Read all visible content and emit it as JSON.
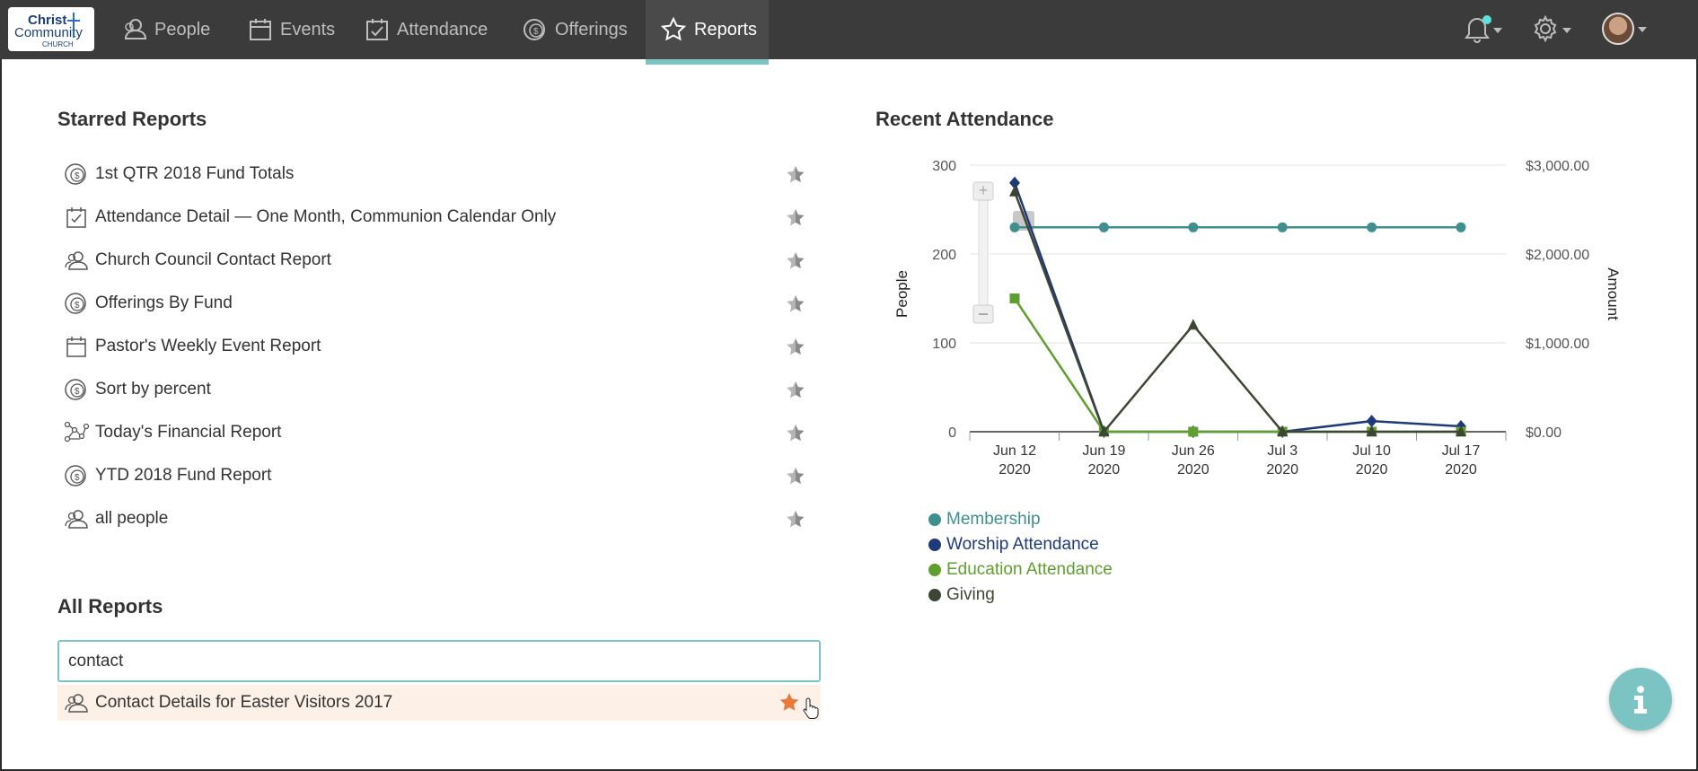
{
  "logo": {
    "line1": "Christ",
    "line2": "Community",
    "line3": "CHURCH"
  },
  "nav": [
    {
      "label": "People",
      "icon": "people-icon"
    },
    {
      "label": "Events",
      "icon": "calendar-icon"
    },
    {
      "label": "Attendance",
      "icon": "calendar-check-icon"
    },
    {
      "label": "Offerings",
      "icon": "coin-icon"
    },
    {
      "label": "Reports",
      "icon": "star-icon",
      "active": true
    }
  ],
  "starred": {
    "title": "Starred Reports",
    "items": [
      {
        "label": "1st QTR 2018 Fund Totals",
        "icon": "coin-icon"
      },
      {
        "label": "Attendance Detail — One Month, Communion Calendar Only",
        "icon": "calendar-check-icon"
      },
      {
        "label": "Church Council Contact Report",
        "icon": "people-icon"
      },
      {
        "label": "Offerings By Fund",
        "icon": "coin-icon"
      },
      {
        "label": "Pastor's Weekly Event Report",
        "icon": "calendar-icon"
      },
      {
        "label": "Sort by percent",
        "icon": "coin-icon"
      },
      {
        "label": "Today's Financial Report",
        "icon": "network-icon"
      },
      {
        "label": "YTD 2018 Fund Report",
        "icon": "coin-icon"
      },
      {
        "label": "all people",
        "icon": "people-icon"
      }
    ]
  },
  "all": {
    "title": "All Reports",
    "search_value": "contact",
    "results": [
      {
        "label": "Contact Details for Easter Visitors 2017",
        "icon": "people-icon"
      }
    ]
  },
  "chart_title": "Recent Attendance",
  "chart_data": {
    "type": "line",
    "categories": [
      "Jun 12 2020",
      "Jun 19 2020",
      "Jun 26 2020",
      "Jul 3 2020",
      "Jul 10 2020",
      "Jul 17 2020"
    ],
    "category_lines": [
      [
        "Jun 12",
        "2020"
      ],
      [
        "Jun 19",
        "2020"
      ],
      [
        "Jun 26",
        "2020"
      ],
      [
        "Jul 3",
        "2020"
      ],
      [
        "Jul 10",
        "2020"
      ],
      [
        "Jul 17",
        "2020"
      ]
    ],
    "ylabel": "People",
    "y2label": "Amount",
    "ylim": [
      0,
      300
    ],
    "y2lim": [
      0,
      3000
    ],
    "yticks": [
      "0",
      "100",
      "200",
      "300"
    ],
    "y2ticks": [
      "$0.00",
      "$1,000.00",
      "$2,000.00",
      "$3,000.00"
    ],
    "grid": true,
    "legend_position": "bottom-left",
    "series": [
      {
        "name": "Membership",
        "color": "#3f8f8f",
        "marker": "circle",
        "axis": "left",
        "values": [
          230,
          230,
          230,
          230,
          230,
          230
        ]
      },
      {
        "name": "Worship Attendance",
        "color": "#1f3a78",
        "marker": "diamond",
        "axis": "left",
        "values": [
          280,
          0,
          0,
          0,
          12,
          6
        ]
      },
      {
        "name": "Education Attendance",
        "color": "#5f9e2f",
        "marker": "square",
        "axis": "left",
        "values": [
          150,
          0,
          0,
          0,
          0,
          0
        ]
      },
      {
        "name": "Giving",
        "color": "#3d4535",
        "marker": "triangle",
        "axis": "right",
        "values": [
          2700,
          0,
          1200,
          0,
          0,
          0
        ]
      }
    ]
  }
}
